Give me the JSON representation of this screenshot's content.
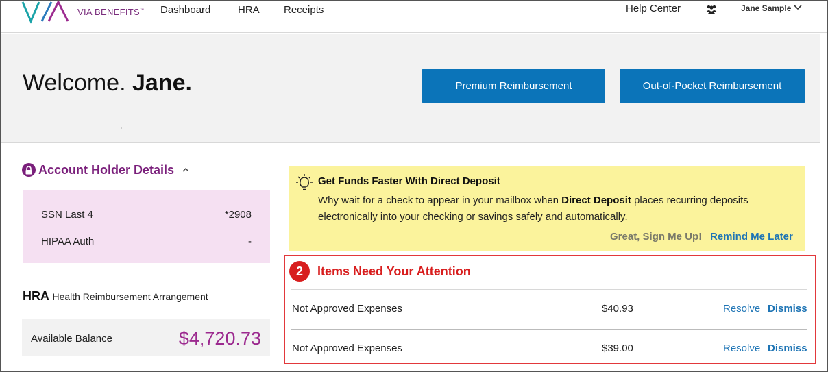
{
  "header": {
    "brand": "VIA BENEFITS",
    "brand_tm": "™",
    "nav": [
      "Dashboard",
      "HRA",
      "Receipts"
    ],
    "active_nav": "Dashboard",
    "help": "Help Center",
    "user": "Jane Sample"
  },
  "hero": {
    "welcome": "Welcome.",
    "name": "Jane.",
    "premium_button": "Premium Reimbursement",
    "oop_button": "Out-of-Pocket Reimbursement"
  },
  "account": {
    "title": "Account Holder Details",
    "rows": [
      {
        "label": "SSN Last 4",
        "value": "*2908"
      },
      {
        "label": "HIPAA Auth",
        "value": "-"
      }
    ]
  },
  "hra": {
    "abbr": "HRA",
    "full": "Health Reimbursement Arrangement",
    "balance_label": "Available Balance",
    "balance_value": "$4,720.73"
  },
  "direct_deposit": {
    "title": "Get Funds Faster With Direct Deposit",
    "body_pre": "Why wait for a check to appear in your mailbox when ",
    "body_bold": "Direct Deposit",
    "body_post": " places recurring deposits electronically into your checking or savings safely and automatically.",
    "sign_up": "Great, Sign Me Up!",
    "remind": "Remind Me Later"
  },
  "attention": {
    "count": "2",
    "title": "Items Need Your Attention",
    "items": [
      {
        "desc": "Not Approved Expenses",
        "amount": "$40.93",
        "resolve": "Resolve",
        "dismiss": "Dismiss"
      },
      {
        "desc": "Not Approved Expenses",
        "amount": "$39.00",
        "resolve": "Resolve",
        "dismiss": "Dismiss"
      }
    ]
  },
  "colors": {
    "primary_blue": "#0b74b9",
    "brand_purple": "#7a1f7b",
    "alert_red": "#d81e1e",
    "banner_yellow": "#fbf39c",
    "account_pink": "#f5e0f2"
  }
}
